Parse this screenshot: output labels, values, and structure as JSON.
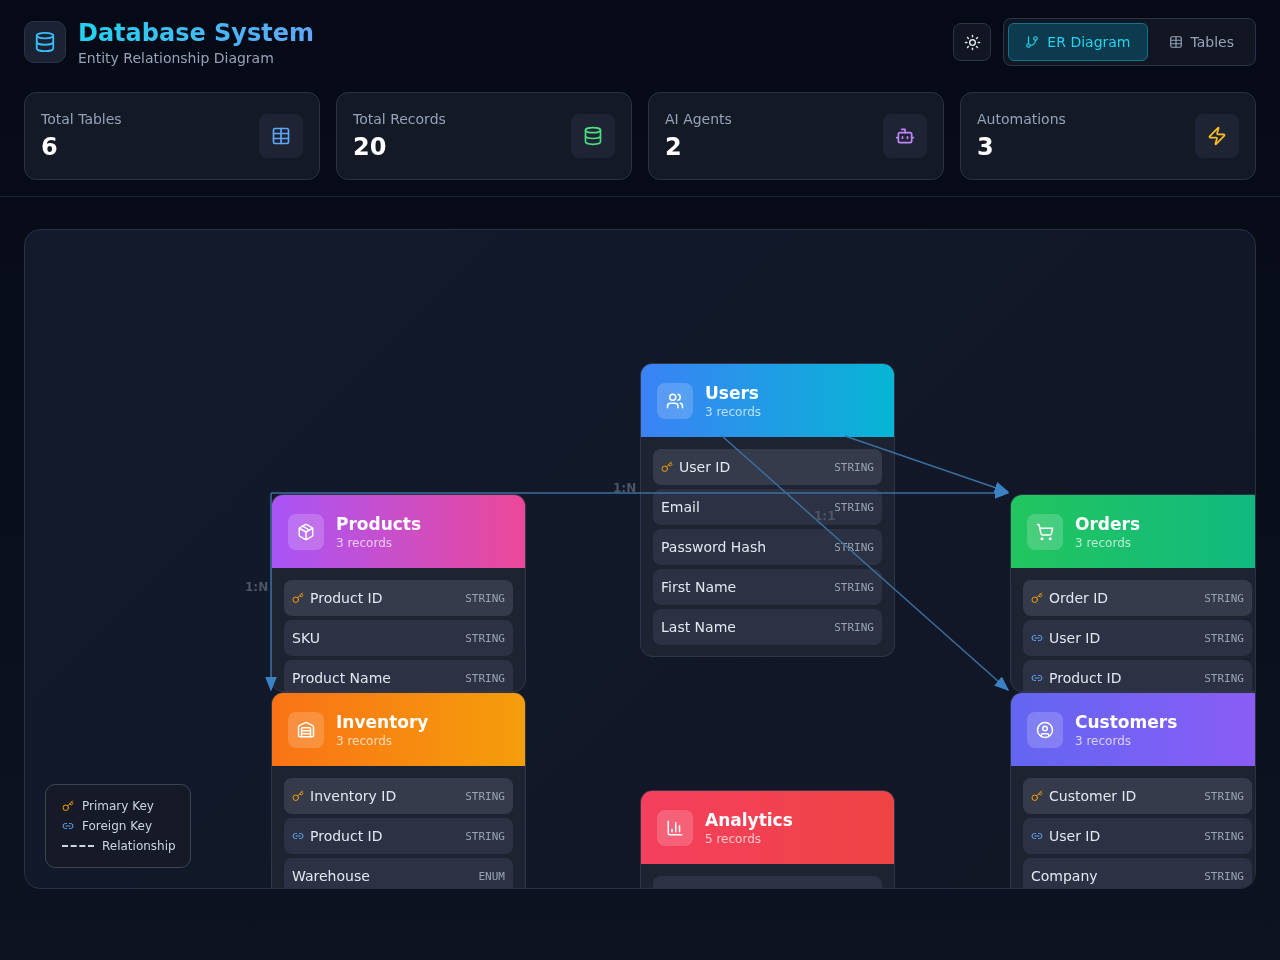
{
  "header": {
    "title": "Database System",
    "subtitle": "Entity Relationship Diagram"
  },
  "view_tabs": [
    {
      "label": "ER Diagram",
      "selected": true
    },
    {
      "label": "Tables",
      "selected": false
    }
  ],
  "stats": [
    {
      "label": "Total Tables",
      "value": "6",
      "color": "#60a5fa"
    },
    {
      "label": "Total Records",
      "value": "20",
      "color": "#4ade80"
    },
    {
      "label": "AI Agents",
      "value": "2",
      "color": "#c084fc"
    },
    {
      "label": "Automations",
      "value": "3",
      "color": "#fbbf24"
    }
  ],
  "tables": [
    {
      "name": "Users",
      "records": "3 records",
      "color": "#3b82f6",
      "fields": [
        {
          "name": "User ID",
          "type": "STRING",
          "kind": "primary"
        },
        {
          "name": "Email",
          "type": "STRING",
          "kind": "plain"
        },
        {
          "name": "Password Hash",
          "type": "STRING",
          "kind": "plain"
        },
        {
          "name": "First Name",
          "type": "STRING",
          "kind": "plain"
        },
        {
          "name": "Last Name",
          "type": "STRING",
          "kind": "plain"
        }
      ]
    },
    {
      "name": "Products",
      "records": "3 records",
      "color": "#a855f7",
      "fields": [
        {
          "name": "Product ID",
          "type": "STRING",
          "kind": "primary"
        },
        {
          "name": "SKU",
          "type": "STRING",
          "kind": "plain"
        },
        {
          "name": "Product Name",
          "type": "STRING",
          "kind": "plain"
        }
      ]
    },
    {
      "name": "Orders",
      "records": "3 records",
      "color": "#22c55e",
      "fields": [
        {
          "name": "Order ID",
          "type": "STRING",
          "kind": "primary"
        },
        {
          "name": "User ID",
          "type": "STRING",
          "kind": "foreign"
        },
        {
          "name": "Product ID",
          "type": "STRING",
          "kind": "foreign"
        }
      ]
    },
    {
      "name": "Inventory",
      "records": "3 records",
      "color": "#f97316",
      "fields": [
        {
          "name": "Inventory ID",
          "type": "STRING",
          "kind": "primary"
        },
        {
          "name": "Product ID",
          "type": "STRING",
          "kind": "foreign"
        },
        {
          "name": "Warehouse",
          "type": "ENUM",
          "kind": "plain"
        }
      ]
    },
    {
      "name": "Customers",
      "records": "3 records",
      "color": "#6366f1",
      "fields": [
        {
          "name": "Customer ID",
          "type": "STRING",
          "kind": "primary"
        },
        {
          "name": "User ID",
          "type": "STRING",
          "kind": "foreign"
        },
        {
          "name": "Company",
          "type": "STRING",
          "kind": "plain"
        }
      ]
    },
    {
      "name": "Analytics",
      "records": "5 records",
      "color": "#f43f5e"
    }
  ],
  "relationships": [
    {
      "label": "1:N"
    },
    {
      "label": "1:1"
    },
    {
      "label": "1:N"
    }
  ],
  "legend": [
    {
      "label": "Primary Key",
      "kind": "primary"
    },
    {
      "label": "Foreign Key",
      "kind": "foreign"
    },
    {
      "label": "Relationship",
      "kind": "line"
    }
  ]
}
